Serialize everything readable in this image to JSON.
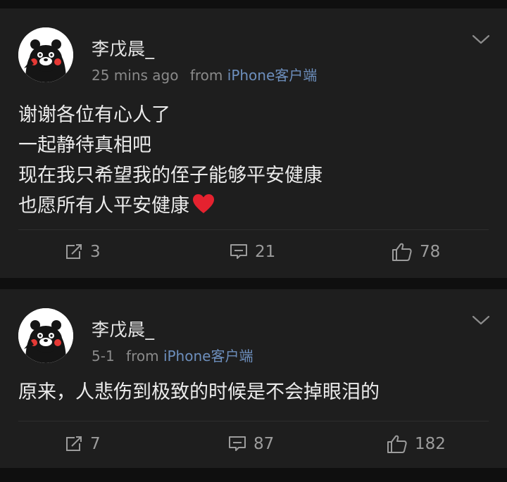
{
  "posts": [
    {
      "username": "李戊晨_",
      "time": "25 mins ago",
      "from_label": "from",
      "source": "iPhone客户端",
      "body_lines": [
        "谢谢各位有心人了",
        "一起静待真相吧",
        "现在我只希望我的侄子能够平安健康",
        "也愿所有人平安健康"
      ],
      "repost_count": "3",
      "comment_count": "21",
      "like_count": "78"
    },
    {
      "username": "李戊晨_",
      "time": "5-1",
      "from_label": "from",
      "source": "iPhone客户端",
      "body_lines": [
        "原来，人悲伤到极致的时候是不会掉眼泪的"
      ],
      "repost_count": "7",
      "comment_count": "87",
      "like_count": "182"
    }
  ],
  "icons": {
    "repost": "repost-icon",
    "comment": "comment-icon",
    "like": "thumbs-up-icon",
    "menu": "chevron-down-icon",
    "emoji": "red-heart-icon"
  },
  "colors": {
    "background": "#0f0f0f",
    "card": "#1e1e1e",
    "source_link": "#6d8fbd",
    "heart": "#e5222f"
  }
}
